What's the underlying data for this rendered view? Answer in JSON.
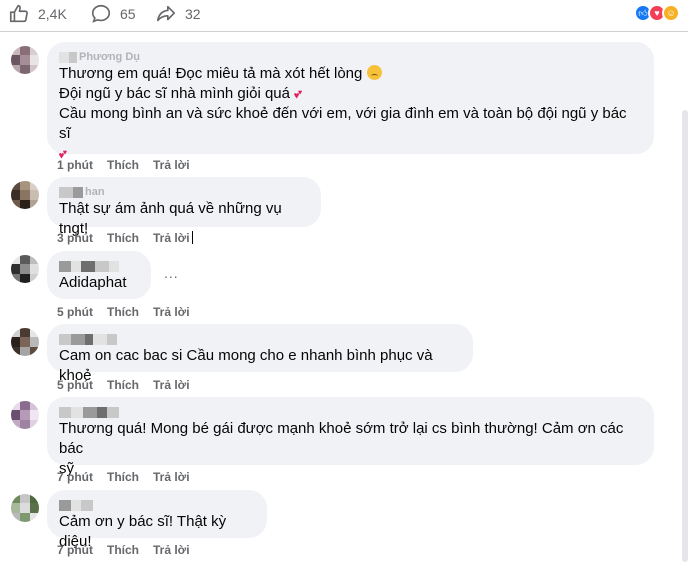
{
  "stats": {
    "likes": "2,4K",
    "comments": "65",
    "shares": "32",
    "like_icon": "thumbs-up-icon",
    "comment_icon": "comment-bubble-icon",
    "share_icon": "share-arrow-icon"
  },
  "reactions": [
    "like",
    "love",
    "care"
  ],
  "colors": {
    "bubble": "#f0f2f5",
    "meta": "#65676b",
    "like": "#1877f2",
    "love": "#f33e58",
    "care": "#f7b125"
  },
  "comments": [
    {
      "author_partial": "Phương Dụ",
      "lines": [
        "Thương em quá! Đọc miêu tả mà xót hết lòng",
        "Đội ngũ y bác sĩ nhà mình giỏi quá",
        "Cầu mong bình an và sức khoẻ đến với em, với gia đình em và toàn bộ đội ngũ y bác sĩ"
      ],
      "time": "1 phút",
      "like": "Thích",
      "reply": "Trả lời"
    },
    {
      "author_partial": "han",
      "lines": [
        "Thật sự ám ảnh quá về những vụ tngt!"
      ],
      "time": "3 phút",
      "like": "Thích",
      "reply": "Trả lời"
    },
    {
      "author_partial": "",
      "lines": [
        "Adidaphat"
      ],
      "time": "5 phút",
      "like": "Thích",
      "reply": "Trả lời",
      "more": "..."
    },
    {
      "author_partial": "",
      "lines": [
        "Cam on cac bac si Cầu mong cho e nhanh bình phục và khoẻ"
      ],
      "time": "5 phút",
      "like": "Thích",
      "reply": "Trả lời"
    },
    {
      "author_partial": "",
      "lines": [
        "Thương quá! Mong bé gái được mạnh khoẻ sớm trở lại cs bình thường! Cảm ơn các bác",
        "sỹ"
      ],
      "time": "7 phút",
      "like": "Thích",
      "reply": "Trả lời"
    },
    {
      "author_partial": "",
      "lines": [
        "Cảm ơn y bác sĩ! Thật kỳ diệu!"
      ],
      "time": "7 phút",
      "like": "Thích",
      "reply": "Trả lời"
    }
  ]
}
